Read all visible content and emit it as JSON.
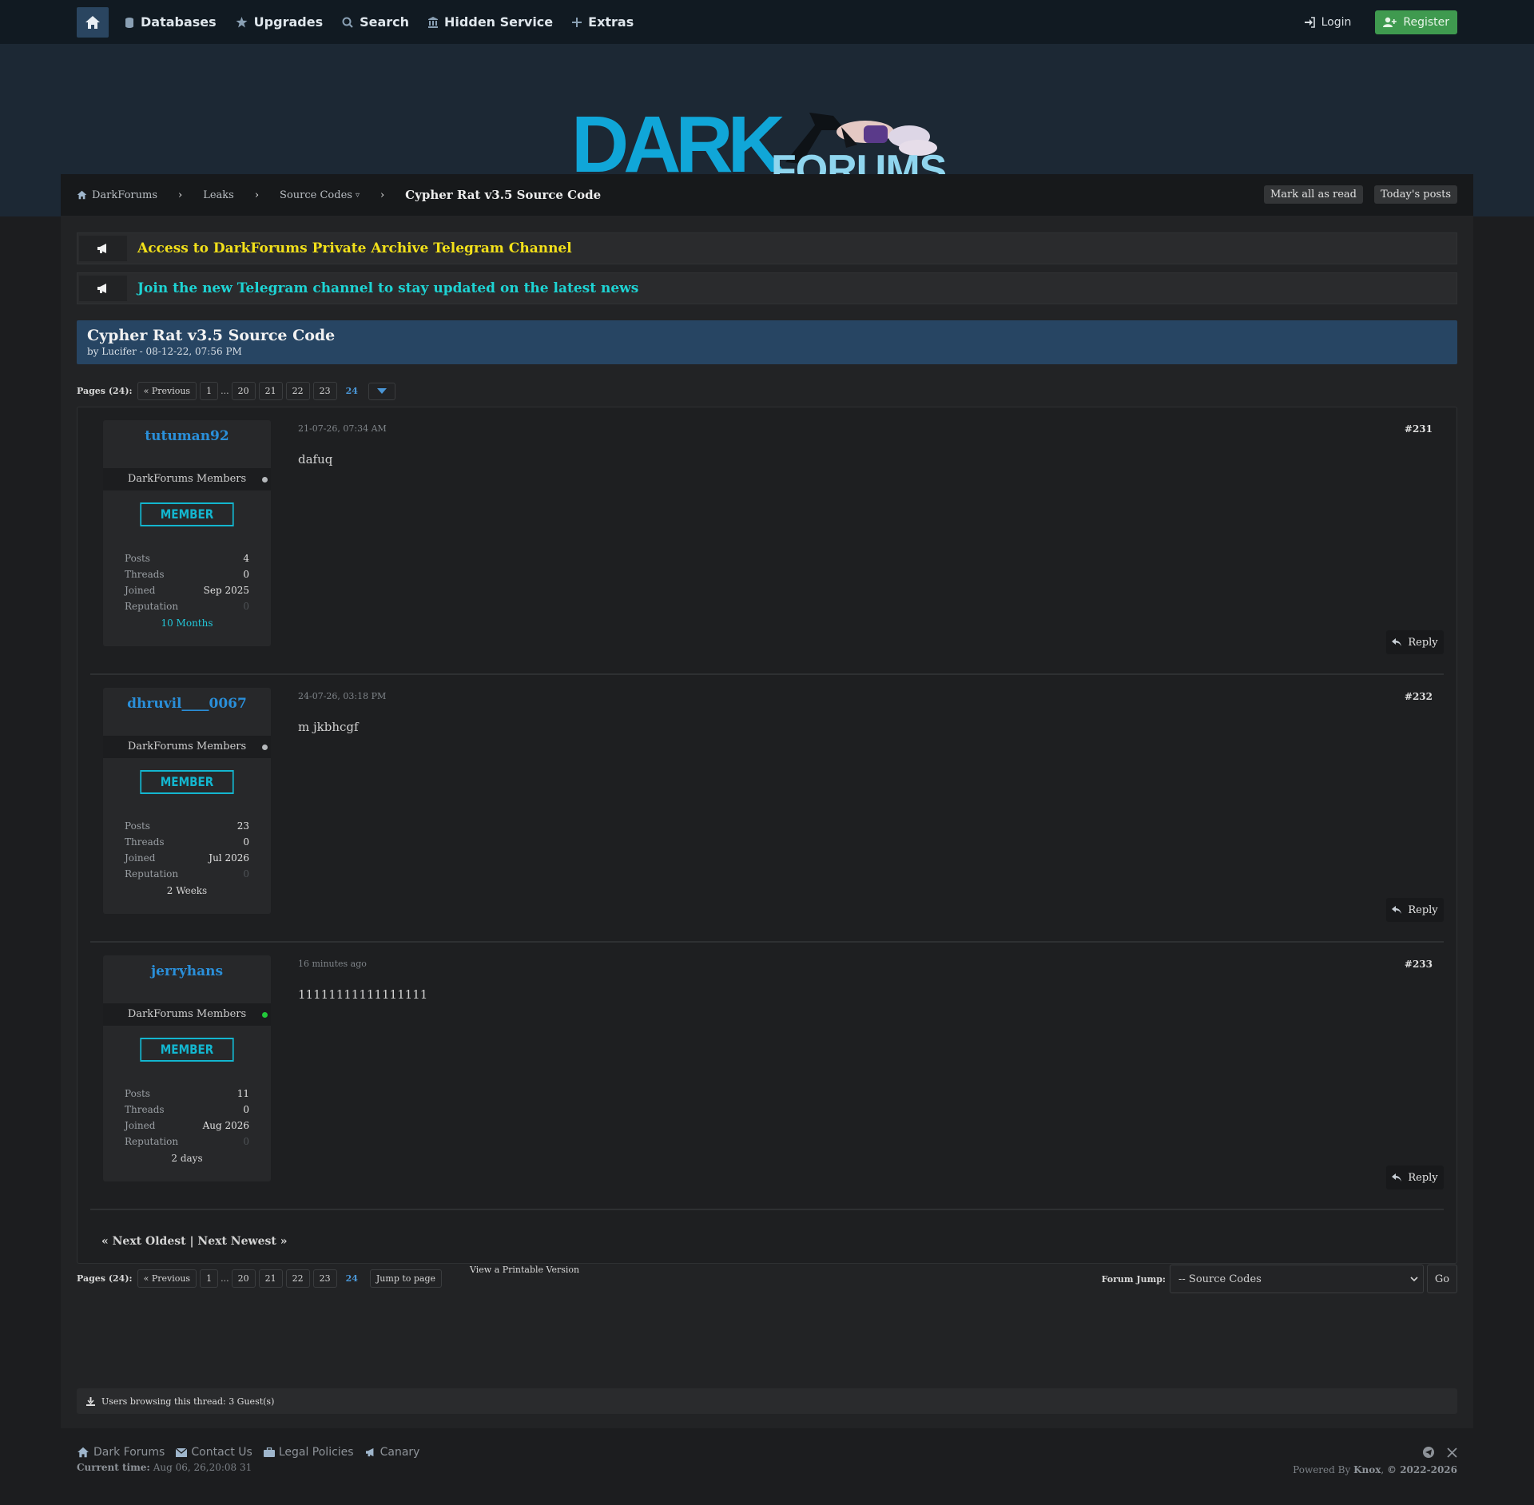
{
  "nav": {
    "items": [
      {
        "label": "Databases",
        "icon": "database-icon"
      },
      {
        "label": "Upgrades",
        "icon": "star-icon"
      },
      {
        "label": "Search",
        "icon": "search-icon"
      },
      {
        "label": "Hidden Service",
        "icon": "building-icon"
      },
      {
        "label": "Extras",
        "icon": "plus-icon"
      }
    ],
    "login": "Login",
    "register": "Register"
  },
  "logo": {
    "dark": "DARK",
    "forums": "FORUMS"
  },
  "breadcrumb": {
    "items": [
      "DarkForums",
      "Leaks",
      "Source Codes"
    ],
    "current": "Cypher Rat v3.5 Source Code",
    "mark_read": "Mark all as read",
    "todays_posts": "Today's posts"
  },
  "announcements": [
    {
      "text": "Access to DarkForums Private Archive Telegram Channel",
      "color": "#f2e01a"
    },
    {
      "text": "Join the new Telegram channel to stay updated on the latest news",
      "color": "#1ed3d3"
    }
  ],
  "thread": {
    "title": "Cypher Rat v3.5 Source Code",
    "byline": "by Lucifer - 08-12-22, 07:56 PM"
  },
  "pagination": {
    "label": "Pages (24):",
    "previous": "« Previous",
    "pages": [
      "1",
      "...",
      "20",
      "21",
      "22",
      "23",
      "24"
    ],
    "current": "24",
    "jump": "Jump to page"
  },
  "posts": [
    {
      "username": "tutuman92",
      "group": "DarkForums Members",
      "online": false,
      "badge": "MEMBER",
      "stats": {
        "posts_label": "Posts",
        "posts": "4",
        "threads_label": "Threads",
        "threads": "0",
        "joined_label": "Joined",
        "joined": "Sep 2025",
        "rep_label": "Reputation",
        "rep": "0"
      },
      "tenure": "10 Months",
      "date": "21-07-26, 07:34 AM",
      "number": "#231",
      "body": "dafuq",
      "reply": "Reply"
    },
    {
      "username": "dhruvil____0067",
      "group": "DarkForums Members",
      "online": false,
      "badge": "MEMBER",
      "stats": {
        "posts_label": "Posts",
        "posts": "23",
        "threads_label": "Threads",
        "threads": "0",
        "joined_label": "Joined",
        "joined": "Jul 2026",
        "rep_label": "Reputation",
        "rep": "0"
      },
      "tenure": "2 Weeks",
      "date": "24-07-26, 03:18 PM",
      "number": "#232",
      "body": "m jkbhcgf",
      "reply": "Reply"
    },
    {
      "username": "jerryhans",
      "group": "DarkForums Members",
      "online": true,
      "badge": "MEMBER",
      "stats": {
        "posts_label": "Posts",
        "posts": "11",
        "threads_label": "Threads",
        "threads": "0",
        "joined_label": "Joined",
        "joined": "Aug 2026",
        "rep_label": "Reputation",
        "rep": "0"
      },
      "tenure": "2 days",
      "date": "16 minutes ago",
      "number": "#233",
      "body": "11111111111111111",
      "reply": "Reply"
    }
  ],
  "next_links": "« Next Oldest | Next Newest »",
  "printable": "View a Printable Version",
  "forum_jump": {
    "label": "Forum Jump:",
    "selected": "-- Source Codes",
    "go": "Go"
  },
  "browsing": "Users browsing this thread: 3 Guest(s)",
  "footer": {
    "links": [
      {
        "label": "Dark Forums",
        "icon": "home-icon"
      },
      {
        "label": "Contact Us",
        "icon": "envelope-icon"
      },
      {
        "label": "Legal Policies",
        "icon": "briefcase-icon"
      },
      {
        "label": "Canary",
        "icon": "megaphone-icon"
      }
    ],
    "current_time_label": "Current time:",
    "current_time": "Aug 06, 26,20:08 31",
    "powered_by": "Powered By",
    "powered_name": "Knox",
    "copyright": "© 2022-2026"
  }
}
